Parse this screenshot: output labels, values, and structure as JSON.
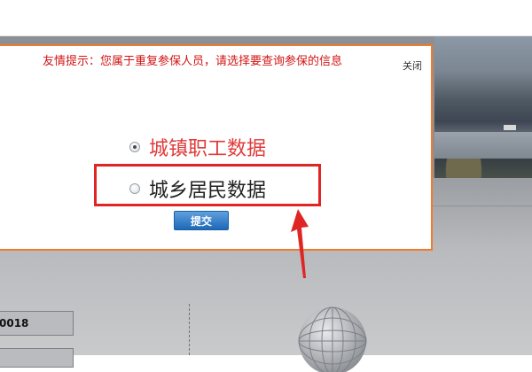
{
  "dialog": {
    "notice": "友情提示：您属于重复参保人员，请选择要查询参保的信息",
    "close_label": "关闭",
    "options": [
      {
        "label": "城镇职工数据",
        "checked": true
      },
      {
        "label": "城乡居民数据",
        "checked": false
      }
    ],
    "submit_label": "提交"
  },
  "page": {
    "code_value": "0018"
  },
  "colors": {
    "dialog_border": "#f07b2b",
    "notice_text": "#d21414",
    "highlight": "#e02525",
    "button": "#1d68b8"
  }
}
